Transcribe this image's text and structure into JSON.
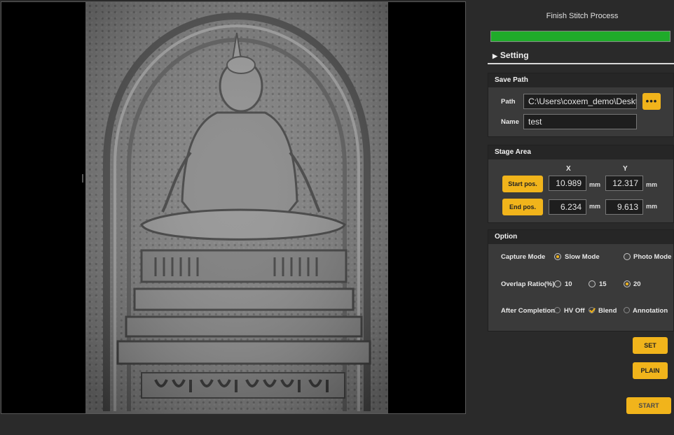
{
  "process": {
    "title": "Finish Stitch Process",
    "progress": 1.0
  },
  "setting": {
    "label": "Setting"
  },
  "save_path": {
    "title": "Save Path",
    "path_label": "Path",
    "path_value": "C:\\Users\\coxem_demo\\Deskt",
    "browse_label": "•••",
    "name_label": "Name",
    "name_value": "test"
  },
  "stage_area": {
    "title": "Stage Area",
    "x_header": "X",
    "y_header": "Y",
    "start_label": "Start pos.",
    "end_label": "End pos.",
    "start_x": "10.989",
    "start_y": "12.317",
    "end_x": "6.234",
    "end_y": "9.613",
    "unit": "mm"
  },
  "option": {
    "title": "Option",
    "capture_label": "Capture Mode",
    "capture_options": [
      "Slow Mode",
      "Photo Mode"
    ],
    "capture_selected": "Slow Mode",
    "overlap_label": "Overlap Ratio(%)",
    "overlap_options": [
      "10",
      "15",
      "20"
    ],
    "overlap_selected": "20",
    "after_label": "After Completion",
    "after_options": [
      "HV Off",
      "Blend",
      "Annotation"
    ],
    "after_checked": [
      "Blend"
    ]
  },
  "buttons": {
    "set": "SET",
    "plain": "PLAIN",
    "start": "START"
  },
  "colors": {
    "accent": "#f1b41b",
    "progress": "#1fab2a",
    "background": "#2a2a2a"
  }
}
